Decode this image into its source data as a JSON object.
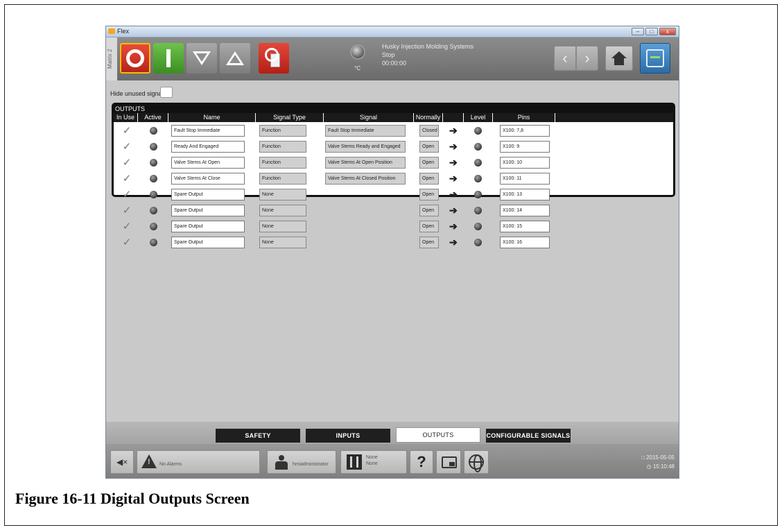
{
  "window": {
    "title": "Flex",
    "matrix_label": "Matrix 2"
  },
  "status": {
    "company": "Husky Injection Molding Systems",
    "state": "Stop",
    "time": "00:00:00",
    "unit": "°C"
  },
  "toolbar": {
    "prev_glyph": "‹",
    "next_glyph": "›"
  },
  "hide_unused": {
    "label": "Hide unused signals"
  },
  "outputs": {
    "title": "OUTPUTS",
    "columns": {
      "in_use": "In Use",
      "active": "Active",
      "name": "Name",
      "signal_type": "Signal Type",
      "signal": "Signal",
      "normally": "Normally",
      "level": "Level",
      "pins": "Pins"
    },
    "rows": [
      {
        "name": "Fault Stop Immediate",
        "type": "Function",
        "signal": "Fault Stop Immediate",
        "normally": "Closed",
        "pins": "X100: 7,8"
      },
      {
        "name": "Ready And Engaged",
        "type": "Function",
        "signal": "Valve Stems Ready and Engaged",
        "normally": "Open",
        "pins": "X100: 9"
      },
      {
        "name": "Valve Stems At Open",
        "type": "Function",
        "signal": "Valve Stems At Open Position",
        "normally": "Open",
        "pins": "X100: 10"
      },
      {
        "name": "Valve Stems At Close",
        "type": "Function",
        "signal": "Valve Stems At Closed Position",
        "normally": "Open",
        "pins": "X100: 11"
      },
      {
        "name": "Spare Output",
        "type": "None",
        "signal": "",
        "normally": "Open",
        "pins": "X100: 13"
      },
      {
        "name": "Spare Output",
        "type": "None",
        "signal": "",
        "normally": "Open",
        "pins": "X100: 14"
      },
      {
        "name": "Spare Output",
        "type": "None",
        "signal": "",
        "normally": "Open",
        "pins": "X100: 15"
      },
      {
        "name": "Spare Output",
        "type": "None",
        "signal": "",
        "normally": "Open",
        "pins": "X100: 16"
      }
    ]
  },
  "tabs": {
    "safety": "SAFETY",
    "inputs": "INPUTS",
    "outputs": "OUTPUTS",
    "configurable": "CONFIGURABLE SIGNALS"
  },
  "statusbar": {
    "alarms": "No Alarms",
    "user": "hmiadministrator",
    "mold_line1": "None",
    "mold_line2": "None",
    "help": "?",
    "date": "□ 2015-05-05",
    "time": "◷ 15:10:48"
  },
  "caption": "Figure 16-11 Digital Outputs Screen"
}
